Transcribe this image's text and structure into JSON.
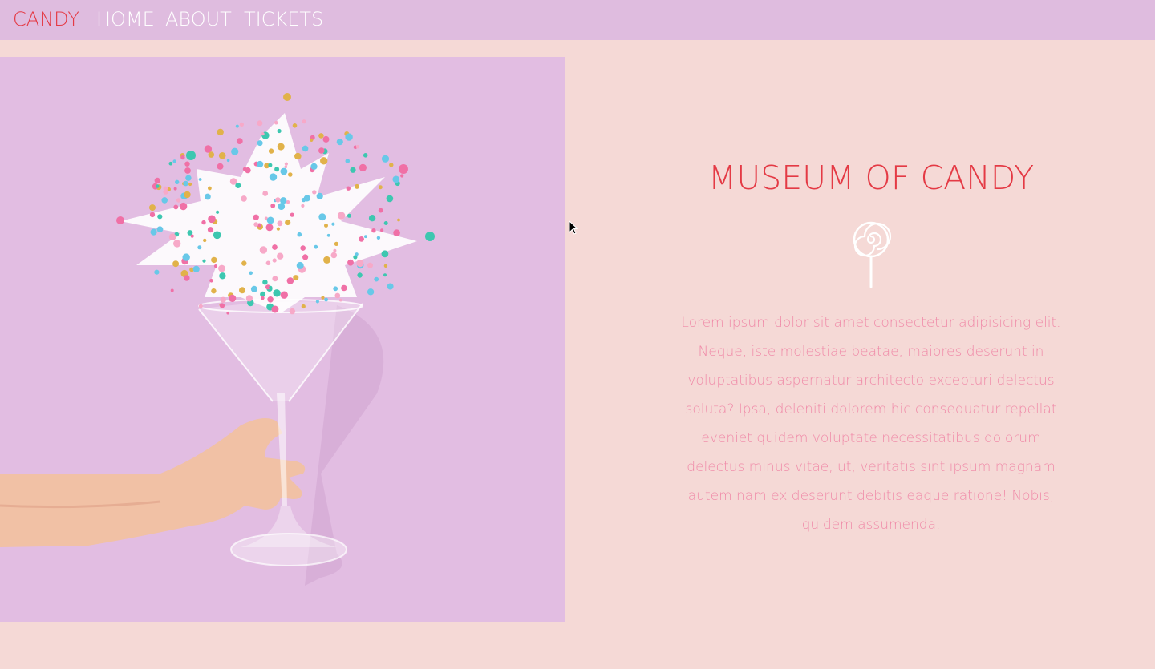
{
  "nav": {
    "brand": "CANDY",
    "links": [
      {
        "label": "HOME"
      },
      {
        "label": "ABOUT"
      },
      {
        "label": "TICKETS"
      }
    ]
  },
  "hero": {
    "title": "MUSEUM OF CANDY",
    "icon": "lollipop-icon",
    "description": "Lorem ipsum dolor sit amet consectetur adipisicing elit. Neque, iste molestiae beatae, maiores deserunt in voluptatibus aspernatur architecto excepturi delectus soluta? Ipsa, deleniti dolorem hic consequatur repellat eveniet quidem voluptate necessitatibus dolorum delectus minus vitae, ut, veritatis sint ipsum magnam autem nam ex deserunt debitis eaque ratione! Nobis, quidem assumenda."
  },
  "colors": {
    "page_background": "#f5d9d6",
    "navbar_background": "#dfbcdf",
    "brand": "#e43a45",
    "image_background": "#e2bde2",
    "description_text": "#f08aa8"
  }
}
